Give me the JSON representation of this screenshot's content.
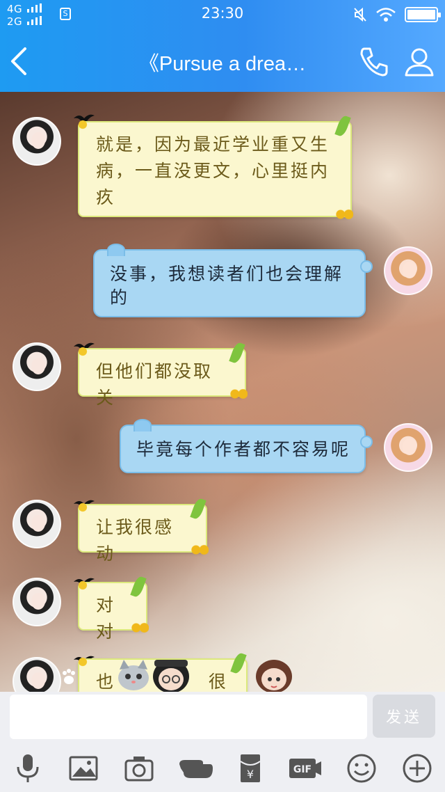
{
  "status_bar": {
    "signal_1": "4G",
    "signal_2": "2G",
    "sim_label": "S",
    "time": "23:30"
  },
  "nav": {
    "title": "《Pursue a drea…"
  },
  "messages": [
    {
      "side": "left",
      "text": "就是，因为最近学业重又生病，一直没更文，心里挺内疚"
    },
    {
      "side": "right",
      "text": "没事，我想读者们也会理解的"
    },
    {
      "side": "left",
      "text": "但他们都没取关"
    },
    {
      "side": "right",
      "text": "毕竟每个作者都不容易呢"
    },
    {
      "side": "left",
      "text": "让我很感动"
    },
    {
      "side": "left",
      "text": "对对"
    },
    {
      "side": "left",
      "text_visible_start": "也",
      "text_visible_end": "很暖"
    }
  ],
  "input": {
    "value": "",
    "placeholder": ""
  },
  "send_label": "发送",
  "toolbar_icons": [
    "microphone-icon",
    "image-icon",
    "camera-icon",
    "hand-icon",
    "red-packet-icon",
    "gif-icon",
    "emoji-icon",
    "plus-icon"
  ],
  "colors": {
    "header": "#2f8df1",
    "bubble_left": "#fbf7cf",
    "bubble_right": "#a9d7f3",
    "toolbar_bg": "#eeeff3"
  }
}
